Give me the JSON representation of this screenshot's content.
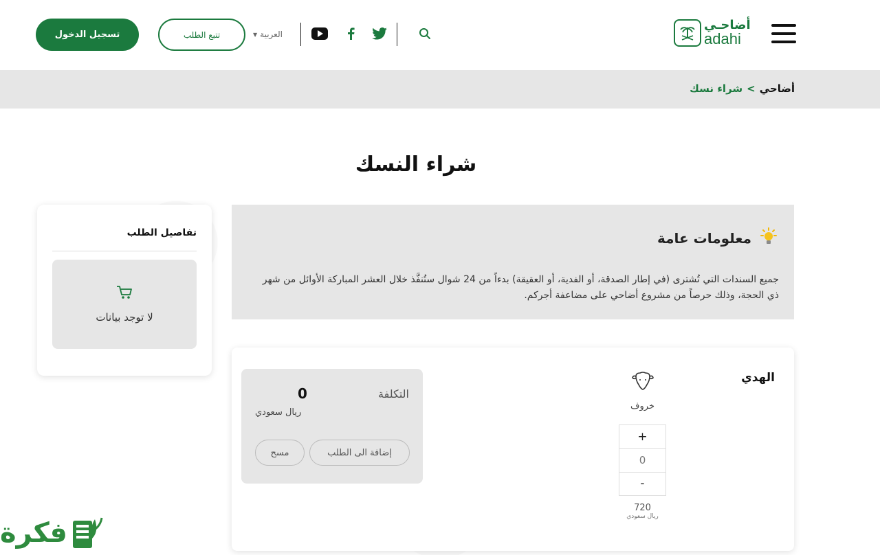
{
  "header": {
    "login_label": "تسجيل الدخول",
    "track_label": "تتبع الطلب",
    "language": "العربية",
    "logo_ar": "أضاحـي",
    "logo_en": "adahi",
    "icons": [
      "youtube-icon",
      "facebook-icon",
      "twitter-icon",
      "search-icon",
      "menu-icon"
    ]
  },
  "breadcrumb": {
    "home": "أضاحي",
    "separator": ">",
    "current": "شراء نسك"
  },
  "page": {
    "title": "شراء النسك"
  },
  "info": {
    "title": "معلومات عامة",
    "text": "جميع السندات التي تُشترى (في إطار الصدقة، أو الفدية، أو العقيقة) بدءاً من 24 شوال ستُنفَّذ خلال العشر المباركة الأوائل من شهر ذي الحجة، وذلك حرصاً من مشروع أضاحي على مضاعفة أجركم."
  },
  "order": {
    "title": "تفاصيل الطلب",
    "empty": "لا توجد بيانات"
  },
  "product": {
    "name": "الهدي",
    "animal": "خروف",
    "quantity": "0",
    "plus": "+",
    "minus": "-",
    "price": "720",
    "price_unit": "ريال سعودي",
    "cost_label": "التكلفة",
    "cost_value": "0",
    "cost_unit": "ريال سعودي",
    "add_label": "إضافة الى الطلب",
    "clear_label": "مسح"
  },
  "watermark": {
    "text": "فكرة"
  },
  "colors": {
    "brand_green": "#1b7a3e",
    "panel_gray": "#e6e6e6"
  }
}
